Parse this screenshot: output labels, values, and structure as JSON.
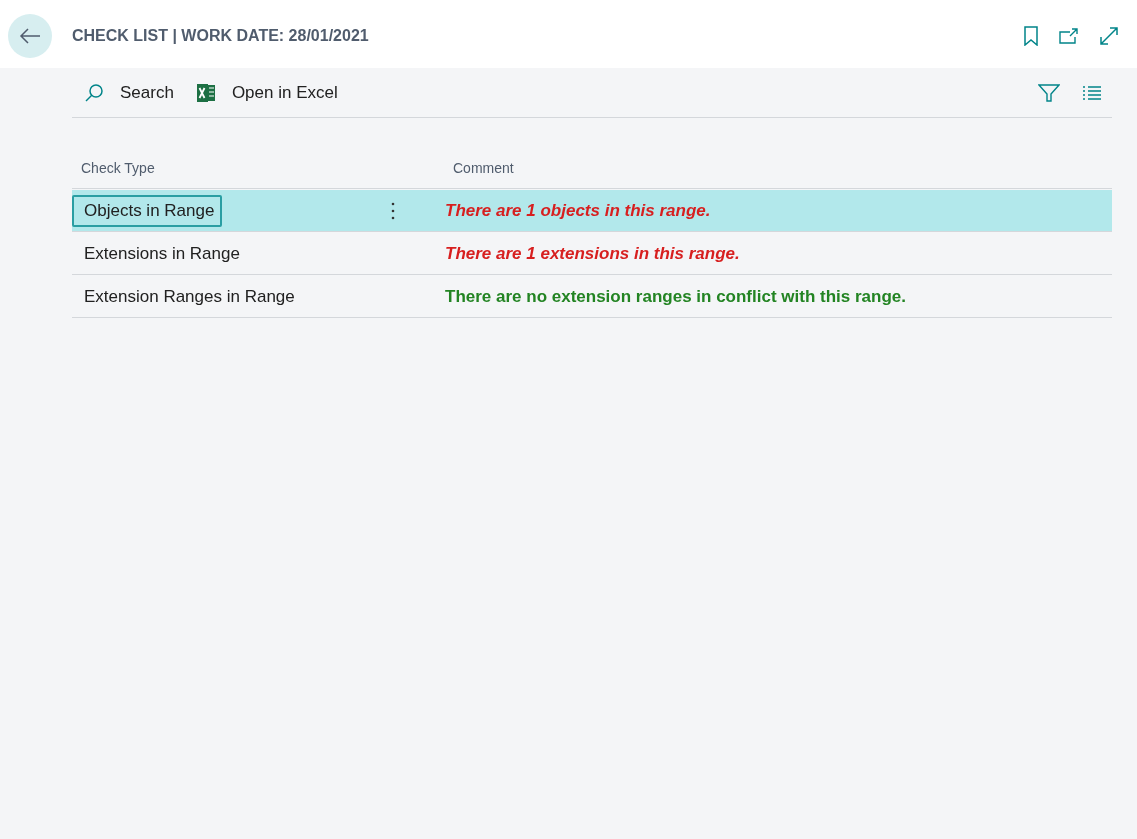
{
  "header": {
    "title": "CHECK LIST | WORK DATE: 28/01/2021"
  },
  "toolbar": {
    "actions": [
      {
        "kind": "search",
        "label": "Search"
      },
      {
        "kind": "excel",
        "label": "Open in Excel"
      }
    ]
  },
  "table": {
    "columns": [
      "Check Type",
      "Comment"
    ],
    "rows": [
      {
        "check_type": "Objects in Range",
        "comment": "There are 1 objects in this range.",
        "kind": "warning",
        "selected": true
      },
      {
        "check_type": "Extensions in Range",
        "comment": "There are 1 extensions in this range.",
        "kind": "warning",
        "selected": false
      },
      {
        "check_type": "Extension Ranges in Range",
        "comment": "There are no extension ranges in conflict with this range.",
        "kind": "ok",
        "selected": false
      }
    ]
  }
}
